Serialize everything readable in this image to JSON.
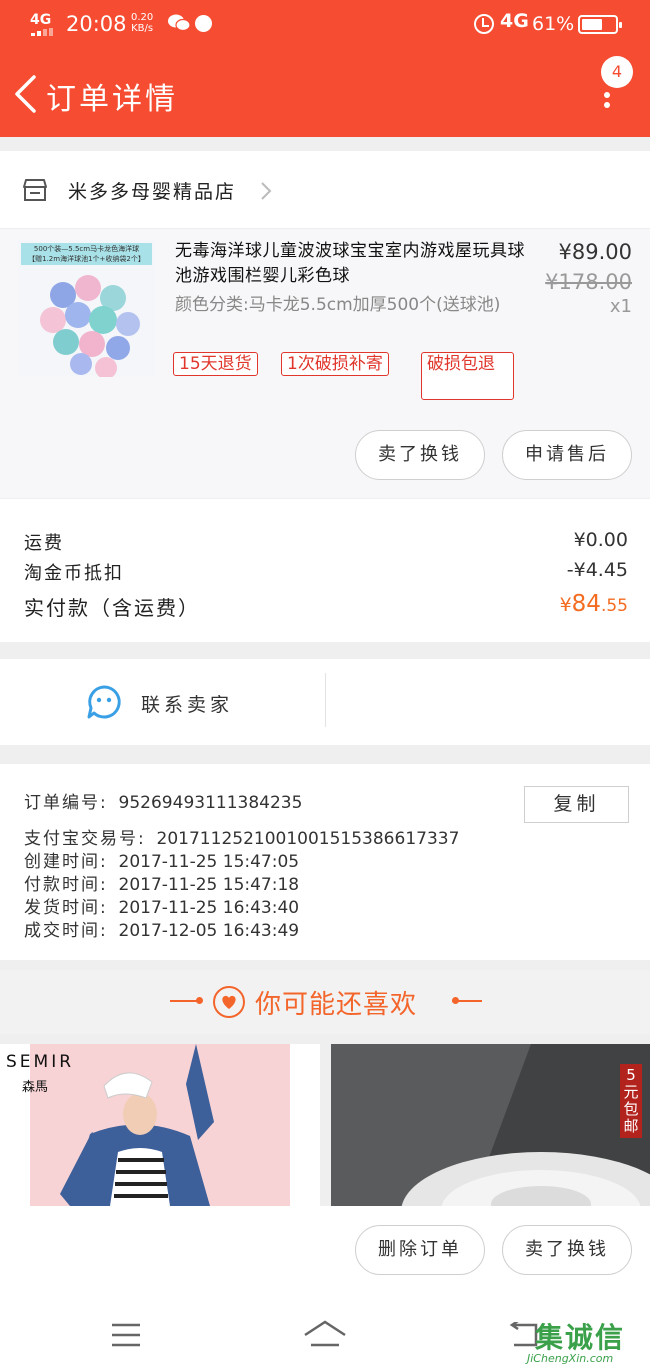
{
  "status_bar": {
    "network": "4G",
    "time": "20:08",
    "speed_value": "0.20",
    "speed_unit": "KB/s",
    "lte": "4G",
    "battery": "61%"
  },
  "nav": {
    "title": "订单详情",
    "badge": "4"
  },
  "shop": {
    "name": "米多多母婴精品店"
  },
  "product": {
    "image_banner_line1": "500个装—5.5cm马卡龙色海洋球",
    "image_banner_line2": "【赠1.2m海洋球池1个+收纳袋2个】",
    "title": "无毒海洋球儿童波波球宝宝室内游戏屋玩具球池游戏围栏婴儿彩色球",
    "sku": "颜色分类:马卡龙5.5cm加厚500个(送球池)",
    "price": "¥89.00",
    "original_price": "¥178.00",
    "quantity": "x1",
    "tags": [
      "15天退货",
      "1次破损补寄",
      "破损包退"
    ],
    "buttons": {
      "sell": "卖了换钱",
      "after_sale": "申请售后"
    }
  },
  "fees": {
    "shipping_label": "运费",
    "shipping_value": "¥0.00",
    "coin_label": "淘金币抵扣",
    "coin_value": "-¥4.45",
    "paid_label": "实付款（含运费）",
    "paid_currency": "¥",
    "paid_int": "84",
    "paid_dec": ".55"
  },
  "contact": {
    "label": "联系卖家"
  },
  "order_info": {
    "order_no_label": "订单编号:",
    "order_no": "95269493111384235",
    "copy_label": "复制",
    "alipay_label": "支付宝交易号:",
    "alipay_no": "2017112521001001515386617337",
    "created_label": "创建时间:",
    "created": "2017-11-25 15:47:05",
    "paid_label": "付款时间:",
    "paid": "2017-11-25 15:47:18",
    "shipped_label": "发货时间:",
    "shipped": "2017-11-25 16:43:40",
    "completed_label": "成交时间:",
    "completed": "2017-12-05 16:43:49"
  },
  "recommend": {
    "title": "你可能还喜欢",
    "item1_brand": "SEMIR",
    "item1_brand_cn": "森馬",
    "item2_promo": "5元包邮"
  },
  "bottom_actions": {
    "delete": "删除订单",
    "sell": "卖了换钱"
  },
  "watermark": {
    "cn": "集诚信",
    "en": "JiChengXin.com"
  },
  "colors": {
    "brand": "#f54c32",
    "accent_orange": "#f36c21",
    "tag_red": "#e0362c"
  }
}
